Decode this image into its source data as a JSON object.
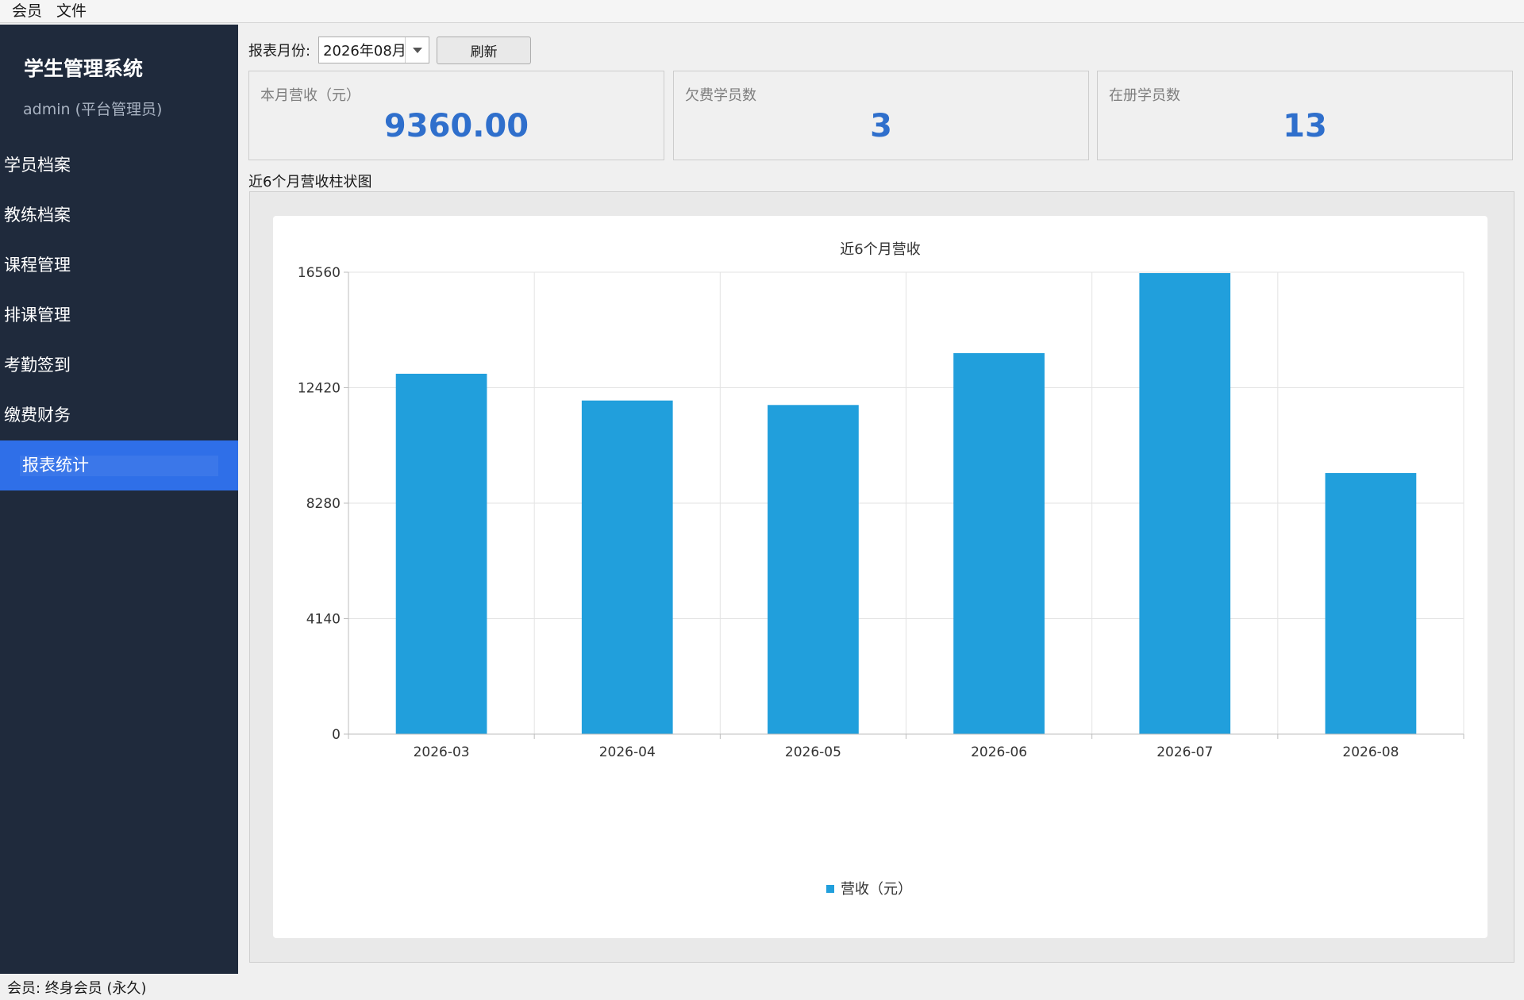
{
  "menubar": {
    "items": [
      "会员",
      "文件"
    ]
  },
  "sidebar": {
    "title": "学生管理系统",
    "user": "admin (平台管理员)",
    "items": [
      {
        "label": "学员档案"
      },
      {
        "label": "教练档案"
      },
      {
        "label": "课程管理"
      },
      {
        "label": "排课管理"
      },
      {
        "label": "考勤签到"
      },
      {
        "label": "缴费财务"
      },
      {
        "label": "报表统计"
      }
    ],
    "active_index": 6
  },
  "toolbar": {
    "month_label": "报表月份:",
    "month_value": "2026年08月",
    "refresh_label": "刷新"
  },
  "stats": [
    {
      "label": "本月营收（元）",
      "value": "9360.00"
    },
    {
      "label": "欠费学员数",
      "value": "3"
    },
    {
      "label": "在册学员数",
      "value": "13"
    }
  ],
  "chart_caption": "近6个月营收柱状图",
  "colors": {
    "accent": "#2f6fe8",
    "bar": "#219fdc",
    "stat_value": "#2f6fcc",
    "sidebar_bg": "#1f2a3c"
  },
  "chart_data": {
    "type": "bar",
    "title": "近6个月营收",
    "categories": [
      "2026-03",
      "2026-04",
      "2026-05",
      "2026-06",
      "2026-07",
      "2026-08"
    ],
    "series": [
      {
        "name": "营收（元）",
        "values": [
          12920,
          11960,
          11800,
          13660,
          16530,
          9360
        ]
      }
    ],
    "yticks": [
      0,
      4140,
      8280,
      12420,
      16560
    ],
    "ylim": [
      0,
      16560
    ],
    "grid": true,
    "legend": "bottom-center"
  },
  "statusbar": {
    "text": "会员: 终身会员 (永久)"
  }
}
